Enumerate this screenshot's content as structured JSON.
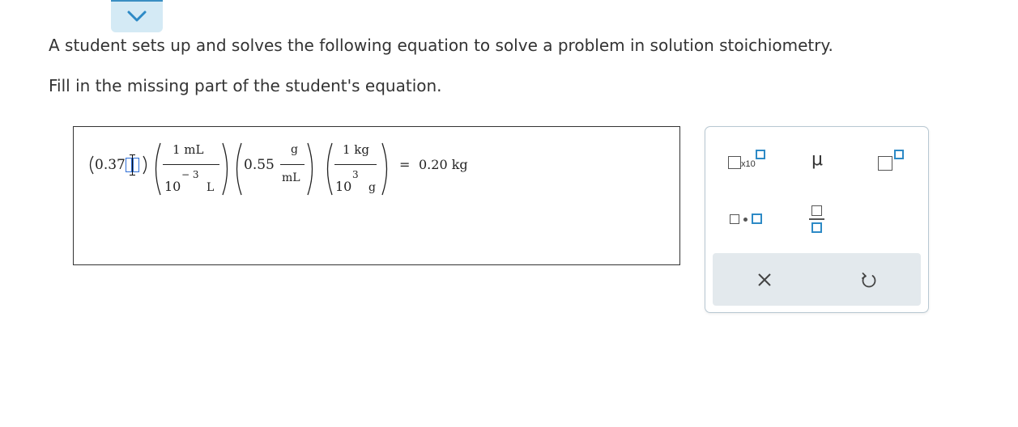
{
  "collapse": {
    "icon": "chevron-down-icon"
  },
  "question": {
    "line1": "A student sets up and solves the following equation to solve a problem in solution stoichiometry.",
    "line2": "Fill in the missing part of the student's equation."
  },
  "equation": {
    "term1_value": "0.37",
    "factor1": {
      "numerator": "1 mL",
      "denominator_base": "10",
      "denominator_exp": "− 3",
      "denominator_unit": "L"
    },
    "factor2": {
      "value": "0.55",
      "numerator_unit": "g",
      "denominator_unit": "mL"
    },
    "factor3": {
      "numerator": "1 kg",
      "denominator_base": "10",
      "denominator_exp": "3",
      "denominator_unit": "g"
    },
    "equals": "=",
    "result": "0.20 kg"
  },
  "palette": {
    "scientific_notation": {
      "icon": "scientific-notation-icon",
      "label": "x10"
    },
    "mu": {
      "icon": "mu-icon",
      "label": "μ"
    },
    "superscript": {
      "icon": "superscript-icon"
    },
    "multiply_dot": {
      "icon": "multiplication-dot-icon"
    },
    "fraction": {
      "icon": "fraction-icon"
    },
    "clear": {
      "icon": "close-icon"
    },
    "undo": {
      "icon": "undo-icon"
    }
  },
  "colors": {
    "accent": "#2d8ac6",
    "accent_light": "#d4eaf5",
    "palette_bar": "#e3e9ed",
    "cursor_box": "#2f6fd6"
  }
}
